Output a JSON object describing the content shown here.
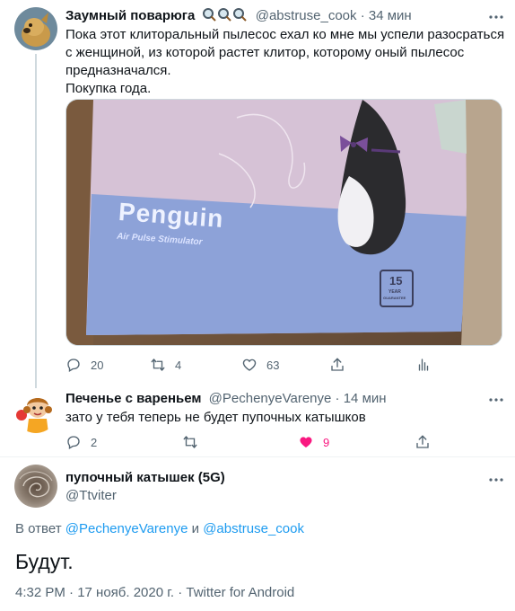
{
  "tweet1": {
    "name": "Заумный поварюга",
    "name_emoji": [
      "magnifier-emoji",
      "magnifier-emoji",
      "magnifier-emoji"
    ],
    "handle": "@abstruse_cook",
    "separator": "·",
    "time": "34 мин",
    "text": "Пока этот клиторальный пылесос ехал ко мне мы успели разосраться с женщиной, из которой растет клитор, которому оный пылесос предназначался.\nПокупка года.",
    "photo": {
      "brand": "Penguin",
      "subtitle": "Air Pulse Stimulator",
      "badge_number": "15",
      "badge_line1": "YEAR",
      "badge_line2": "GUARANTEE"
    },
    "counts": {
      "reply": "20",
      "retweet": "4",
      "like": "63"
    }
  },
  "tweet2": {
    "name": "Печенье с вареньем",
    "handle": "@PechenyeVarenye",
    "separator": "·",
    "time": "14 мин",
    "text": "зато у тебя теперь не будет пупочных катышков",
    "counts": {
      "reply": "2",
      "retweet": "",
      "like": "9"
    }
  },
  "main": {
    "name": "пупочный катышек (5G)",
    "handle": "@Ttviter",
    "reply_prefix": "В ответ",
    "reply_user1": "@PechenyeVarenye",
    "reply_and": "и",
    "reply_user2": "@abstruse_cook",
    "text": "Будут.",
    "meta": "4:32 PM · 17 нояб. 2020 г. · Twitter for Android"
  },
  "colors": {
    "accent": "#1d9bf0",
    "like_active": "#f91880",
    "secondary_text": "#536471",
    "divider": "#eff3f4"
  }
}
